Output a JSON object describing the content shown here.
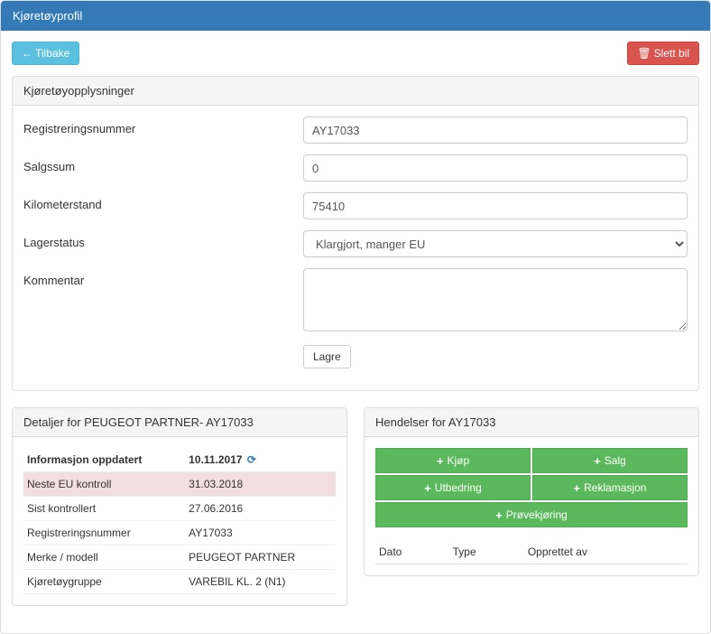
{
  "header": {
    "title": "Kjøretøyprofil"
  },
  "topbar": {
    "back_label": "Tilbake",
    "delete_label": "Slett bil"
  },
  "info_panel": {
    "heading": "Kjøretøyopplysninger",
    "fields": {
      "regnr": {
        "label": "Registreringsnummer",
        "value": "AY17033"
      },
      "salgssum": {
        "label": "Salgssum",
        "value": "0"
      },
      "km": {
        "label": "Kilometerstand",
        "value": "75410"
      },
      "lagerstatus": {
        "label": "Lagerstatus",
        "selected": "Klargjort, manger EU"
      },
      "kommentar": {
        "label": "Kommentar",
        "value": ""
      }
    },
    "save_label": "Lagre"
  },
  "details_panel": {
    "heading": "Detaljer for PEUGEOT PARTNER- AY17033",
    "rows": [
      {
        "label": "Informasjon oppdatert",
        "value": "10.11.2017",
        "style": "info",
        "refresh": true
      },
      {
        "label": "Neste EU kontroll",
        "value": "31.03.2018",
        "style": "warn"
      },
      {
        "label": "Sist kontrollert",
        "value": "27.06.2016",
        "style": ""
      },
      {
        "label": "Registreringsnummer",
        "value": "AY17033",
        "style": ""
      },
      {
        "label": "Merke / modell",
        "value": "PEUGEOT PARTNER",
        "style": ""
      },
      {
        "label": "Kjøretøygruppe",
        "value": "VAREBIL KL. 2 (N1)",
        "style": ""
      }
    ]
  },
  "events_panel": {
    "heading": "Hendelser for AY17033",
    "actions": {
      "kjop": "Kjøp",
      "salg": "Salg",
      "utbedring": "Utbedring",
      "reklamasjon": "Reklamasjon",
      "provekjoring": "Prøvekjøring"
    },
    "table_headers": [
      "Dato",
      "Type",
      "Opprettet av"
    ]
  }
}
